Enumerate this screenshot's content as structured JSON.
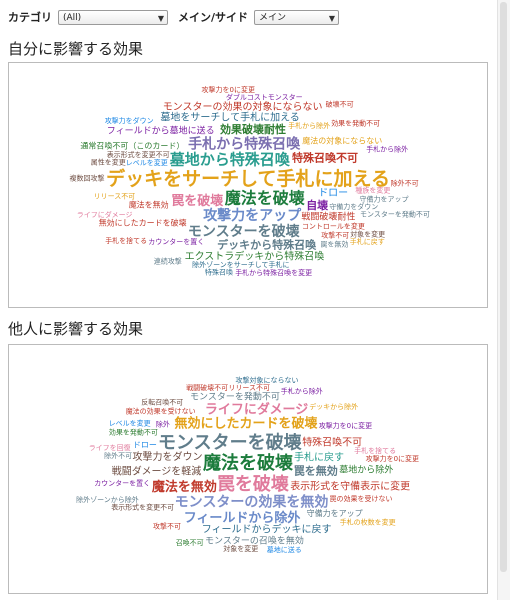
{
  "filters": {
    "category_label": "カテゴリ",
    "category_value": "(All)",
    "mainside_label": "メイン/サイド",
    "mainside_value": "メイン"
  },
  "sections": [
    {
      "title": "自分に影響する効果",
      "words": [
        {
          "text": "デッキをサーチして手札に加える",
          "size": 19,
          "color": "#e3a21a"
        },
        {
          "text": "墓地から特殊召喚",
          "size": 15,
          "color": "#2a9d8f"
        },
        {
          "text": "魔法を破壊",
          "size": 16,
          "color": "#1c7c3c"
        },
        {
          "text": "攻撃力をアップ",
          "size": 14,
          "color": "#6a8ac9"
        },
        {
          "text": "手札から特殊召喚",
          "size": 14,
          "color": "#7b6fb0"
        },
        {
          "text": "モンスターを破壊",
          "size": 14,
          "color": "#607d8b"
        },
        {
          "text": "特殊召喚不可",
          "size": 11,
          "color": "#c0392b"
        },
        {
          "text": "効果破壊耐性",
          "size": 11,
          "color": "#2e7d32"
        },
        {
          "text": "罠を破壊",
          "size": 13,
          "color": "#e07a9c"
        },
        {
          "text": "墓地をサーチして手札に加える",
          "size": 10,
          "color": "#2e6d8e"
        },
        {
          "text": "エクストラデッキから特殊召喚",
          "size": 10,
          "color": "#2e7d32"
        },
        {
          "text": "戦闘破壊耐性",
          "size": 9,
          "color": "#c0392b"
        },
        {
          "text": "フィールドから墓地に送る",
          "size": 9,
          "color": "#7b1fa2"
        },
        {
          "text": "自壊",
          "size": 11,
          "color": "#7b1fa2"
        },
        {
          "text": "モンスターの効果の対象にならない",
          "size": 10,
          "color": "#c0392b"
        },
        {
          "text": "デッキから特殊召喚",
          "size": 11,
          "color": "#607d8b"
        },
        {
          "text": "ドロー",
          "size": 10,
          "color": "#1e88e5"
        },
        {
          "text": "レベルを変更",
          "size": 7,
          "color": "#1e88e5"
        },
        {
          "text": "コントロールを変更",
          "size": 7,
          "color": "#c0392b"
        },
        {
          "text": "表示形式を変更不可",
          "size": 7,
          "color": "#6d4c41"
        },
        {
          "text": "カウンターを置く",
          "size": 7,
          "color": "#7b1fa2"
        },
        {
          "text": "魔法の対象にならない",
          "size": 8,
          "color": "#e3a21a"
        },
        {
          "text": "守備力をダウン",
          "size": 7,
          "color": "#607d8b"
        },
        {
          "text": "手札から除外",
          "size": 7,
          "color": "#e3a21a"
        },
        {
          "text": "種族を変更",
          "size": 7,
          "color": "#e07a9c"
        },
        {
          "text": "攻撃不可",
          "size": 7,
          "color": "#c0392b"
        },
        {
          "text": "リリース不可",
          "size": 7,
          "color": "#e3a21a"
        },
        {
          "text": "守備力をアップ",
          "size": 7,
          "color": "#607d8b"
        },
        {
          "text": "除外ゾーンをサーチして手札に",
          "size": 7,
          "color": "#2e6d8e"
        },
        {
          "text": "ダブルコストモンスター",
          "size": 7,
          "color": "#7b1fa2"
        },
        {
          "text": "効果を発動不可",
          "size": 7,
          "color": "#c0392b"
        },
        {
          "text": "罠を無効",
          "size": 7,
          "color": "#607d8b"
        },
        {
          "text": "無効にしたカードを破壊",
          "size": 8,
          "color": "#c0392b"
        },
        {
          "text": "通常召喚不可（このカード）",
          "size": 8,
          "color": "#2e7d32"
        },
        {
          "text": "魔法を無効",
          "size": 8,
          "color": "#c0392b"
        },
        {
          "text": "手札から除外",
          "size": 7,
          "color": "#7b1fa2"
        },
        {
          "text": "ライフにダメージ",
          "size": 7,
          "color": "#e07a9c"
        },
        {
          "text": "モンスターを発動不可",
          "size": 7,
          "color": "#607d8b"
        },
        {
          "text": "属性を変更",
          "size": 7,
          "color": "#6d4c41"
        },
        {
          "text": "手札から特殊召喚を変更",
          "size": 7,
          "color": "#7b1fa2"
        },
        {
          "text": "対象を変更",
          "size": 7,
          "color": "#6d4c41"
        },
        {
          "text": "手札を捨てる",
          "size": 7,
          "color": "#c0392b"
        },
        {
          "text": "攻撃力をダウン",
          "size": 7,
          "color": "#1e88e5"
        },
        {
          "text": "除外不可",
          "size": 7,
          "color": "#c0392b"
        },
        {
          "text": "手札に戻す",
          "size": 7,
          "color": "#e3a21a"
        },
        {
          "text": "特殊召喚",
          "size": 7,
          "color": "#2e6d8e"
        },
        {
          "text": "攻撃力を0に変更",
          "size": 7,
          "color": "#c0392b"
        },
        {
          "text": "連続攻撃",
          "size": 7,
          "color": "#607d8b"
        },
        {
          "text": "複数回攻撃",
          "size": 7,
          "color": "#6d4c41"
        },
        {
          "text": "破壊不可",
          "size": 7,
          "color": "#c0392b"
        }
      ]
    },
    {
      "title": "他人に影響する効果",
      "words": [
        {
          "text": "魔法を破壊",
          "size": 18,
          "color": "#1c7c3c"
        },
        {
          "text": "罠を破壊",
          "size": 18,
          "color": "#e07a9c"
        },
        {
          "text": "モンスターを破壊",
          "size": 18,
          "color": "#607d8b"
        },
        {
          "text": "モンスターの効果を無効",
          "size": 14,
          "color": "#7e8fc9"
        },
        {
          "text": "無効にしたカードを破壊",
          "size": 13,
          "color": "#e3a21a"
        },
        {
          "text": "フィールドから除外",
          "size": 13,
          "color": "#6a8ac9"
        },
        {
          "text": "ライフにダメージ",
          "size": 13,
          "color": "#e07a9c"
        },
        {
          "text": "魔法を無効",
          "size": 13,
          "color": "#c0392b"
        },
        {
          "text": "罠を無効",
          "size": 11,
          "color": "#607d8b"
        },
        {
          "text": "フィールドからデッキに戻す",
          "size": 10,
          "color": "#2e6d8e"
        },
        {
          "text": "手札に戻す",
          "size": 10,
          "color": "#2a9d8f"
        },
        {
          "text": "戦闘ダメージを軽減",
          "size": 10,
          "color": "#6d4c41"
        },
        {
          "text": "攻撃力をダウン",
          "size": 10,
          "color": "#6d4c41"
        },
        {
          "text": "表示形式を守備表示に変更",
          "size": 10,
          "color": "#c0392b"
        },
        {
          "text": "特殊召喚不可",
          "size": 10,
          "color": "#c0392b"
        },
        {
          "text": "モンスターを発動不可",
          "size": 9,
          "color": "#607d8b"
        },
        {
          "text": "モンスターの召喚を無効",
          "size": 9,
          "color": "#607d8b"
        },
        {
          "text": "ドロー",
          "size": 8,
          "color": "#1e88e5"
        },
        {
          "text": "墓地から除外",
          "size": 9,
          "color": "#2e7d32"
        },
        {
          "text": "守備力をアップ",
          "size": 8,
          "color": "#607d8b"
        },
        {
          "text": "攻撃力を0に変更",
          "size": 7,
          "color": "#7b1fa2"
        },
        {
          "text": "魔法の効果を受けない",
          "size": 7,
          "color": "#c0392b"
        },
        {
          "text": "罠の効果を受けない",
          "size": 7,
          "color": "#c0392b"
        },
        {
          "text": "表示形式を変更不可",
          "size": 7,
          "color": "#6d4c41"
        },
        {
          "text": "カウンターを置く",
          "size": 7,
          "color": "#7b1fa2"
        },
        {
          "text": "効果を発動不可",
          "size": 7,
          "color": "#2e7d32"
        },
        {
          "text": "手札を捨てる",
          "size": 7,
          "color": "#e07a9c"
        },
        {
          "text": "デッキから除外",
          "size": 7,
          "color": "#e3a21a"
        },
        {
          "text": "攻撃不可",
          "size": 7,
          "color": "#c0392b"
        },
        {
          "text": "除外不可",
          "size": 7,
          "color": "#607d8b"
        },
        {
          "text": "リリース不可",
          "size": 7,
          "color": "#c0392b"
        },
        {
          "text": "レベルを変更",
          "size": 7,
          "color": "#1e88e5"
        },
        {
          "text": "反転召喚不可",
          "size": 7,
          "color": "#6d4c41"
        },
        {
          "text": "手札から除外",
          "size": 7,
          "color": "#7b1fa2"
        },
        {
          "text": "対象を変更",
          "size": 7,
          "color": "#6d4c41"
        },
        {
          "text": "攻撃力を0に変更",
          "size": 7,
          "color": "#c0392b"
        },
        {
          "text": "ライフを回復",
          "size": 7,
          "color": "#e07a9c"
        },
        {
          "text": "攻撃対象にならない",
          "size": 7,
          "color": "#2e6d8e"
        },
        {
          "text": "除外ゾーンから除外",
          "size": 7,
          "color": "#607d8b"
        },
        {
          "text": "戦闘破壊不可",
          "size": 7,
          "color": "#c0392b"
        },
        {
          "text": "召喚不可",
          "size": 7,
          "color": "#2e7d32"
        },
        {
          "text": "除外",
          "size": 7,
          "color": "#7b1fa2"
        },
        {
          "text": "手札の枚数を変更",
          "size": 7,
          "color": "#e3a21a"
        },
        {
          "text": "墓地に送る",
          "size": 7,
          "color": "#1e88e5"
        }
      ]
    }
  ]
}
